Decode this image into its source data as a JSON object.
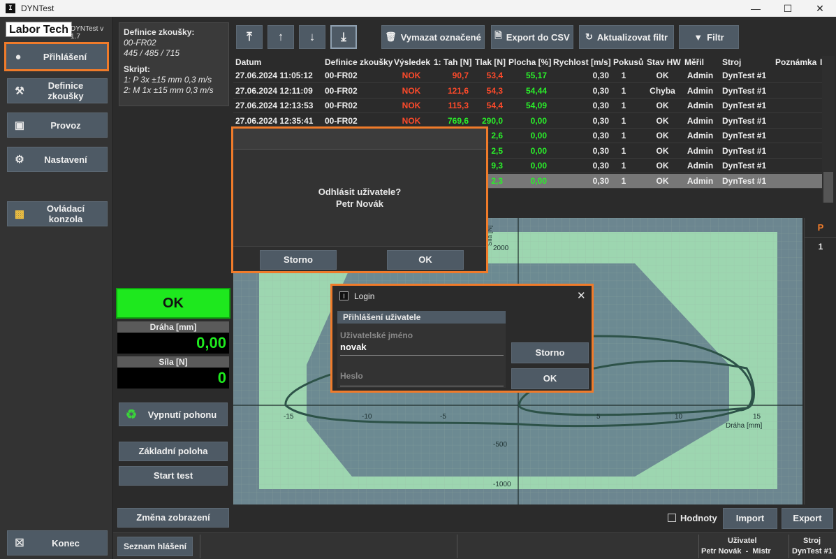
{
  "window": {
    "title": "DYNTest",
    "minimize": "—",
    "maximize": "☐",
    "close": "✕"
  },
  "sidebar": {
    "logo_text": "Labor Tech",
    "version": "DYNTest v 1.7",
    "items": [
      {
        "label": "Přihlášení",
        "icon": "user-icon"
      },
      {
        "label": "Definice zkoušky",
        "icon": "hammer-icon"
      },
      {
        "label": "Provoz",
        "icon": "car-icon"
      },
      {
        "label": "Nastavení",
        "icon": "gear-icon"
      },
      {
        "label": "Ovládací konzola",
        "icon": "console-icon"
      }
    ],
    "exit_label": "Konec"
  },
  "info": {
    "def_title": "Definice zkoušky:",
    "def_name": "00-FR02",
    "def_values": "445 / 485 / 715",
    "script_title": "Skript:",
    "script_line1": "1: P  3x  ±15 mm  0,3 m/s",
    "script_line2": "2: M  1x  ±15 mm  0,3 m/s"
  },
  "status": {
    "result": "OK",
    "draha_label": "Dráha [mm]",
    "draha_value": "0,00",
    "sila_label": "Síla [N]",
    "sila_value": "0",
    "result_color": "#1ee81e"
  },
  "controls": {
    "vypnuti": "Vypnutí pohonu",
    "zakladni": "Základní poloha",
    "start": "Start test",
    "zmena": "Změna zobrazení"
  },
  "toolbar": {
    "vymazat": "Vymazat označené",
    "export_csv": "Export do CSV",
    "aktualizovat": "Aktualizovat filtr",
    "filtr": "Filtr"
  },
  "table": {
    "headers": [
      "Datum",
      "Definice zkoušky",
      "Výsledek",
      "1: Tah [N]",
      "Tlak [N]",
      "Plocha [%]",
      "Rychlost [m/s]",
      "Pokusů",
      "Stav HW",
      "Měřil",
      "Stroj",
      "Poznámka",
      "I"
    ],
    "rows": [
      [
        "27.06.2024 11:05:12",
        "00-FR02",
        "NOK",
        "90,7",
        "53,4",
        "55,17",
        "0,30",
        "1",
        "OK",
        "Admin",
        "DynTest #1"
      ],
      [
        "27.06.2024 12:11:09",
        "00-FR02",
        "NOK",
        "121,6",
        "54,3",
        "54,44",
        "0,30",
        "1",
        "Chyba",
        "Admin",
        "DynTest #1"
      ],
      [
        "27.06.2024 12:13:53",
        "00-FR02",
        "NOK",
        "115,3",
        "54,4",
        "54,09",
        "0,30",
        "1",
        "OK",
        "Admin",
        "DynTest #1"
      ],
      [
        "27.06.2024 12:35:41",
        "00-FR02",
        "NOK",
        "769,6",
        "290,0",
        "0,00",
        "0,30",
        "1",
        "OK",
        "Admin",
        "DynTest #1"
      ],
      [
        "",
        "",
        "",
        "",
        "2,6",
        "0,00",
        "0,30",
        "1",
        "OK",
        "Admin",
        "DynTest #1"
      ],
      [
        "",
        "",
        "",
        "",
        "2,5",
        "0,00",
        "0,30",
        "1",
        "OK",
        "Admin",
        "DynTest #1"
      ],
      [
        "",
        "",
        "",
        "",
        "9,3",
        "0,00",
        "0,30",
        "1",
        "OK",
        "Admin",
        "DynTest #1"
      ],
      [
        "",
        "",
        "",
        "",
        "2,3",
        "0,00",
        "0,30",
        "1",
        "OK",
        "Admin",
        "DynTest #1"
      ]
    ]
  },
  "chart": {
    "x_ticks": [
      "-15",
      "-10",
      "-5",
      "5",
      "10",
      "15"
    ],
    "y_ticks": [
      "2000",
      "-500",
      "-1000"
    ],
    "x_axis_label": "Dráha [mm]",
    "y_axis_label": "Síla [N]"
  },
  "right_strip": {
    "header": "P",
    "value": "1"
  },
  "bottom": {
    "hodnoty": "Hodnoty",
    "import": "Import",
    "export": "Export",
    "seznam": "Seznam hlášení",
    "uzivatel_label": "Uživatel",
    "uzivatel_value": "Petr Novák  -  Mistr",
    "stroj_label": "Stroj",
    "stroj_value": "DynTest #1"
  },
  "logout_dialog": {
    "question": "Odhlásit uživatele?",
    "name": "Petr Novák",
    "cancel": "Storno",
    "ok": "OK"
  },
  "login_dialog": {
    "title": "Login",
    "section": "Přihlášení uživatele",
    "username_label": "Uživatelské jméno",
    "username_value": "novak",
    "password_label": "Heslo",
    "cancel": "Storno",
    "ok": "OK"
  },
  "colors": {
    "accent": "#f07b2a",
    "button": "#4e5a65",
    "ok_green": "#1ee81e",
    "nok_red": "#ff4a2a"
  }
}
